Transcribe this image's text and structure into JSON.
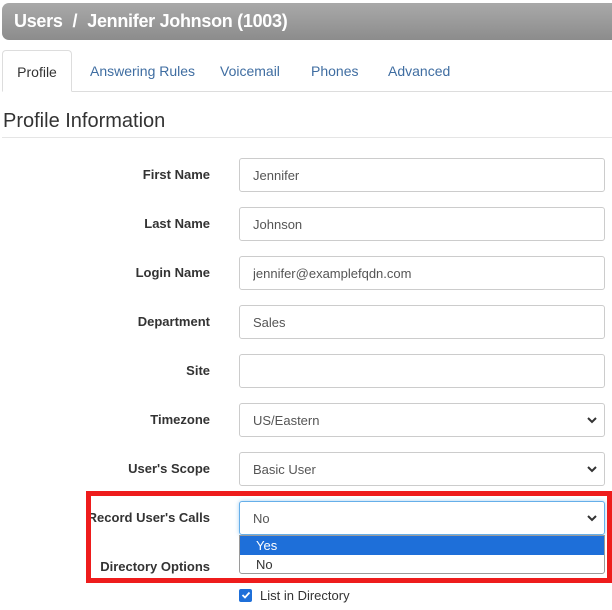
{
  "header": {
    "section": "Users",
    "separator": "/",
    "user": "Jennifer Johnson (1003)"
  },
  "tabs": [
    {
      "label": "Profile",
      "active": true
    },
    {
      "label": "Answering Rules",
      "active": false
    },
    {
      "label": "Voicemail",
      "active": false
    },
    {
      "label": "Phones",
      "active": false
    },
    {
      "label": "Advanced",
      "active": false
    }
  ],
  "profile": {
    "title": "Profile Information",
    "fields": {
      "first_name": {
        "label": "First Name",
        "value": "Jennifer"
      },
      "last_name": {
        "label": "Last Name",
        "value": "Johnson"
      },
      "login_name": {
        "label": "Login Name",
        "value": "jennifer@examplefqdn.com"
      },
      "department": {
        "label": "Department",
        "value": "Sales"
      },
      "site": {
        "label": "Site",
        "value": ""
      },
      "timezone": {
        "label": "Timezone",
        "value": "US/Eastern"
      },
      "scope": {
        "label": "User's Scope",
        "value": "Basic User"
      },
      "record_calls": {
        "label": "Record User's Calls",
        "value": "No"
      },
      "directory_options": {
        "label": "Directory Options"
      }
    },
    "record_calls_dropdown": {
      "options": [
        "Yes",
        "No"
      ],
      "highlighted": "Yes"
    },
    "list_in_directory": {
      "label": "List in Directory",
      "checked": true
    }
  },
  "colors": {
    "link": "#3f6da1",
    "highlight_outline": "#ee1c1c",
    "selection": "#1e6fd9"
  }
}
